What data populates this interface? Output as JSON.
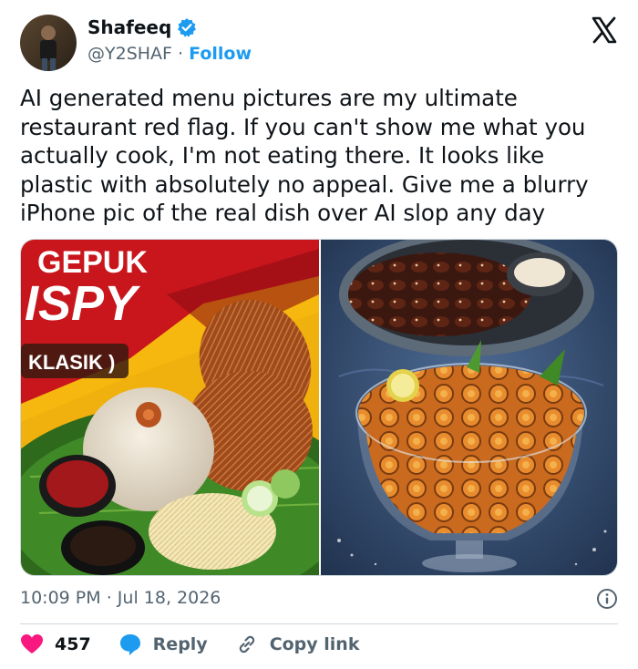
{
  "author": {
    "display_name": "Shafeeq",
    "handle": "@Y2SHAF",
    "separator": "·",
    "follow_label": "Follow"
  },
  "tweet": {
    "text": "AI generated menu pictures are my ultimate restaurant red flag. If you can't show me what you actually cook, I'm not eating there. It looks like plastic with absolutely no appeal. Give me a blurry iPhone pic of the real dish over AI slop any day"
  },
  "media": {
    "left_image": {
      "line1": "GEPUK",
      "line2": "ISPY",
      "line3": "KLASIK )"
    }
  },
  "meta": {
    "time": "10:09 PM",
    "separator": "·",
    "date": "Jul 18, 2026"
  },
  "actions": {
    "like_count": "457",
    "reply_label": "Reply",
    "copy_label": "Copy link"
  },
  "colors": {
    "accent": "#1d9bf0",
    "like": "#f91880",
    "muted": "#536471",
    "text": "#0f1419"
  },
  "icons": [
    "verified-badge-icon",
    "x-logo-icon",
    "info-icon",
    "heart-icon",
    "reply-bubble-icon",
    "link-icon"
  ]
}
